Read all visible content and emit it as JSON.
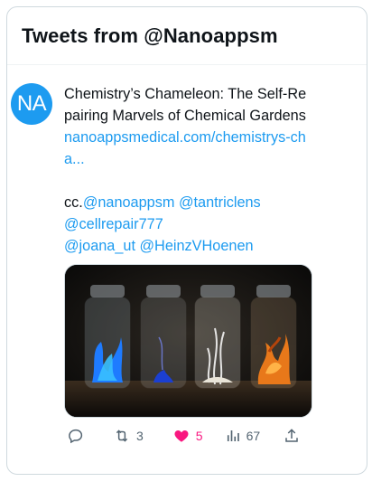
{
  "header": {
    "title": "Tweets from @Nanoappsm"
  },
  "tweet": {
    "avatar_text": "NA",
    "title_text": "Chemistry’s Chameleon: The Self-Repairing Marvels of Chemical Gardens",
    "link_text": "nanoappsmedical.com/chemistrys-cha...",
    "cc_prefix": "cc.",
    "mentions": [
      "@nanoappsm",
      "@tantriclens",
      "@cellrepair777",
      "@joana_ut",
      "@HeinzVHoenen"
    ],
    "actions": {
      "retweets": "3",
      "likes": "5",
      "views": "67"
    },
    "colors": {
      "accent": "#1d9bf0",
      "like": "#f91880",
      "text": "#0f1419",
      "muted": "#536471"
    }
  },
  "icons": {
    "reply": "reply-icon",
    "retweet": "retweet-icon",
    "like": "heart-icon",
    "views": "views-icon",
    "share": "share-icon"
  }
}
